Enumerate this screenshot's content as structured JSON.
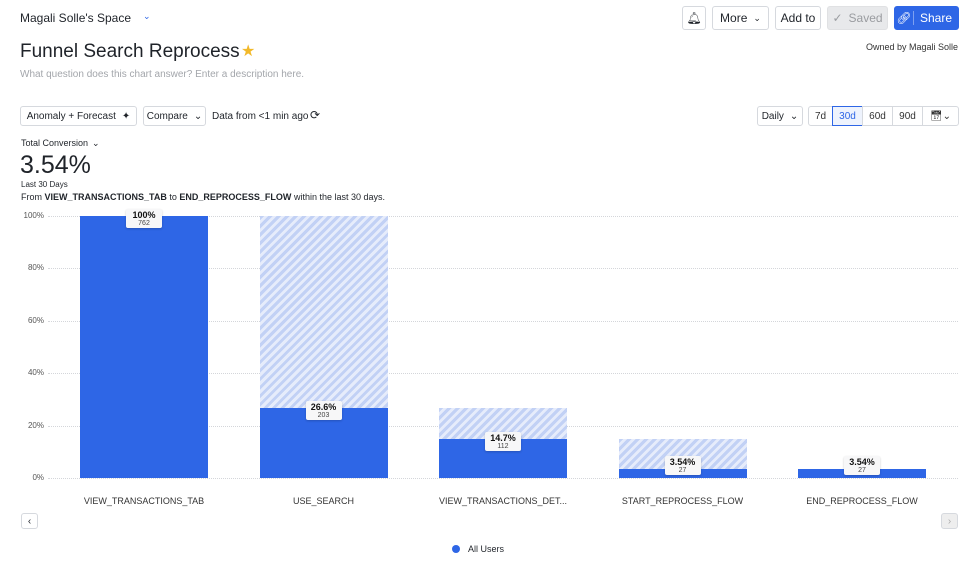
{
  "header": {
    "space": "Magali Solle's Space",
    "title": "Funnel Search Reprocess",
    "description_placeholder": "What question does this chart answer? Enter a description here.",
    "owner": "Owned by Magali Solle",
    "more": "More",
    "add_to": "Add to",
    "saved": "Saved",
    "share": "Share"
  },
  "toolbar": {
    "anomaly": "Anomaly + Forecast",
    "compare": "Compare",
    "data_from": "Data from <1 min ago",
    "interval": "Daily",
    "ranges": [
      "7d",
      "30d",
      "60d",
      "90d"
    ],
    "active_range": "30d"
  },
  "summary": {
    "metric": "Total Conversion",
    "value": "3.54%",
    "period": "Last 30 Days",
    "from_prefix": "From",
    "from_event": "VIEW_TRANSACTIONS_TAB",
    "to_word": "to",
    "to_event": "END_REPROCESS_FLOW",
    "suffix": "within the last 30 days."
  },
  "legend": {
    "series": "All Users",
    "color": "#2e66e6"
  },
  "chart_data": {
    "type": "bar",
    "ylim": [
      0,
      100
    ],
    "y_ticks": [
      "0%",
      "20%",
      "40%",
      "60%",
      "80%",
      "100%"
    ],
    "categories": [
      "VIEW_TRANSACTIONS_TAB",
      "USE_SEARCH",
      "VIEW_TRANSACTIONS_DET...",
      "START_REPROCESS_FLOW",
      "END_REPROCESS_FLOW"
    ],
    "series": [
      {
        "name": "All Users",
        "values": [
          100,
          26.6,
          14.7,
          3.54,
          3.54
        ],
        "labels": [
          "100%",
          "26.6%",
          "14.7%",
          "3.54%",
          "3.54%"
        ],
        "counts": [
          762,
          203,
          112,
          27,
          27
        ]
      }
    ]
  }
}
